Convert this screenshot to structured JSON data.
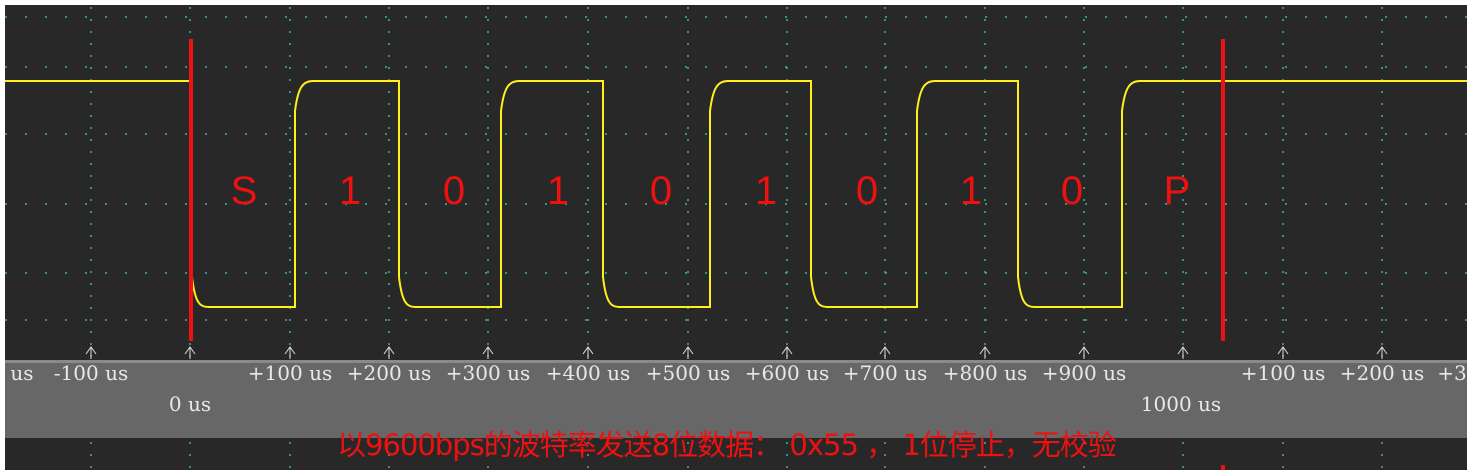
{
  "scope": {
    "background": "#282828",
    "grid_color": "#3ab5a5",
    "trace_color": "#ffef1a",
    "cursor_color": "#ee1111",
    "axis_band_color": "#676767"
  },
  "bits": [
    {
      "label": "S"
    },
    {
      "label": "1"
    },
    {
      "label": "0"
    },
    {
      "label": "1"
    },
    {
      "label": "0"
    },
    {
      "label": "1"
    },
    {
      "label": "0"
    },
    {
      "label": "1"
    },
    {
      "label": "0"
    },
    {
      "label": "P"
    }
  ],
  "axis_labels": {
    "row1": [
      {
        "text": "us"
      },
      {
        "text": "-100 us"
      },
      {
        "text": "+100 us"
      },
      {
        "text": "+200 us"
      },
      {
        "text": "+300 us"
      },
      {
        "text": "+400 us"
      },
      {
        "text": "+500 us"
      },
      {
        "text": "+600 us"
      },
      {
        "text": "+700 us"
      },
      {
        "text": "+800 us"
      },
      {
        "text": "+900 us"
      },
      {
        "text": "+100 us"
      },
      {
        "text": "+200 us"
      },
      {
        "text": "+3"
      }
    ],
    "row2": [
      {
        "text": "0 us"
      },
      {
        "text": "1000 us"
      }
    ]
  },
  "caption": "以9600bps的波特率发送8位数据： 0x55 ， 1位停止，无校验"
}
